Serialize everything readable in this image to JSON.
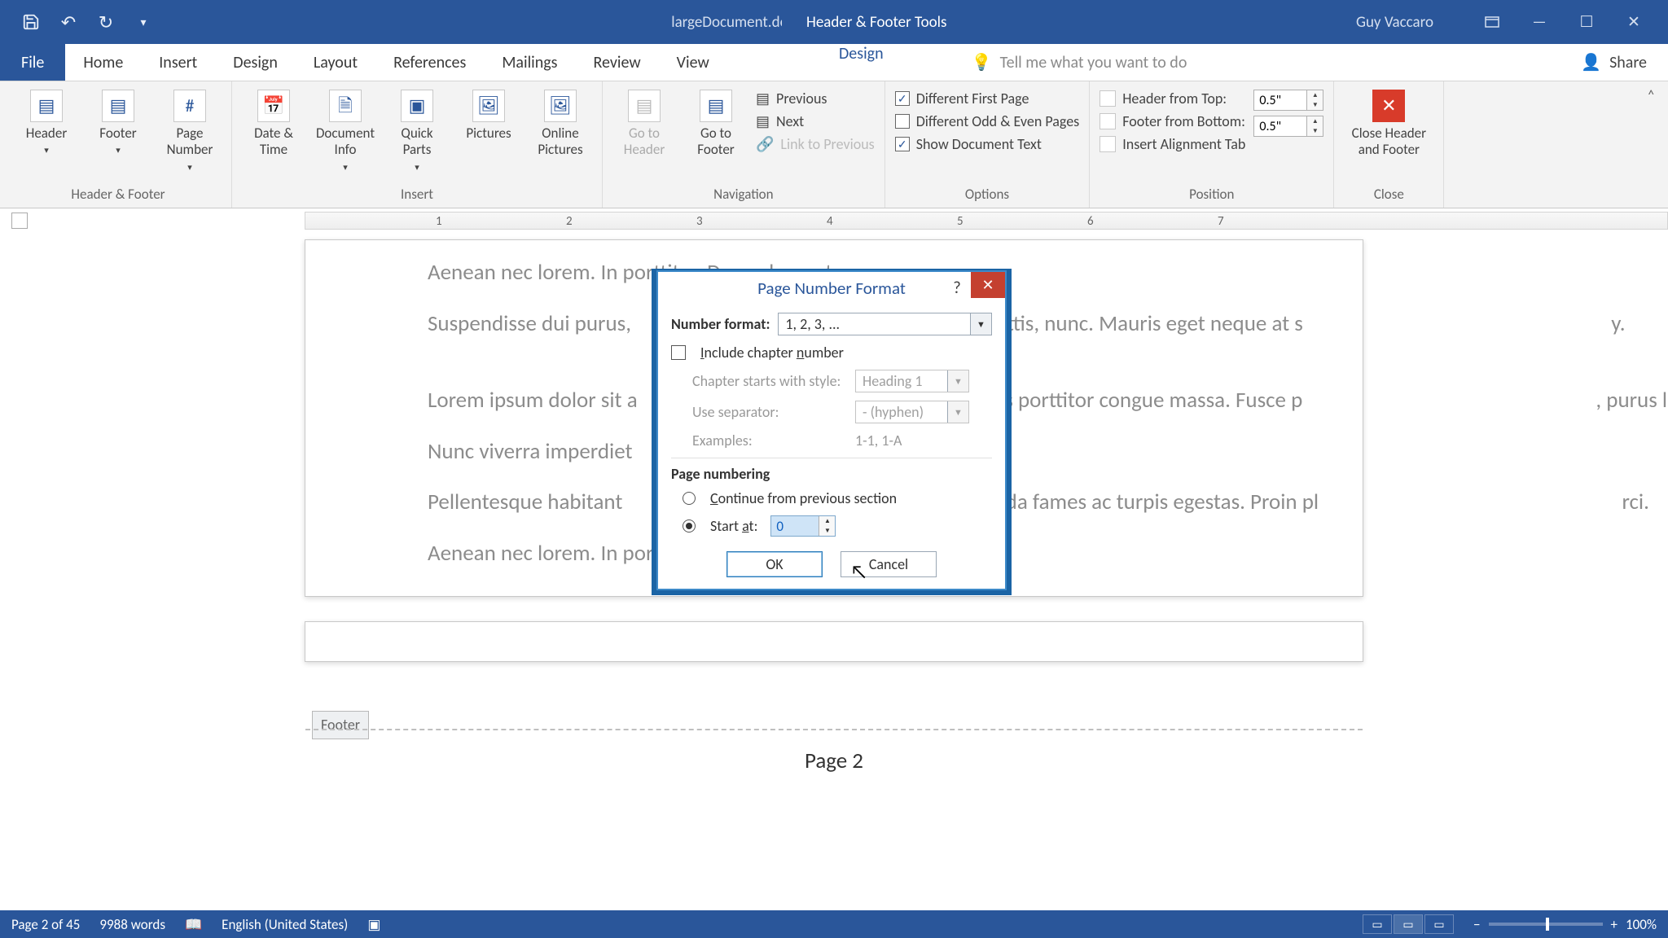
{
  "titlebar": {
    "doc_title": "largeDocument.docx - Word",
    "context_tab": "Header & Footer Tools",
    "user": "Guy Vaccaro"
  },
  "tabs": {
    "file": "File",
    "home": "Home",
    "insert": "Insert",
    "design": "Design",
    "layout": "Layout",
    "references": "References",
    "mailings": "Mailings",
    "review": "Review",
    "view": "View",
    "ctx_design": "Design",
    "tellme": "Tell me what you want to do",
    "share": "Share"
  },
  "ribbon": {
    "hf": {
      "label": "Header & Footer",
      "header": "Header",
      "footer": "Footer",
      "pagenum": "Page Number"
    },
    "insert": {
      "label": "Insert",
      "datetime": "Date & Time",
      "docinfo": "Document Info",
      "quickparts": "Quick Parts",
      "pictures": "Pictures",
      "online": "Online Pictures"
    },
    "nav": {
      "label": "Navigation",
      "gotoheader": "Go to Header",
      "gotofooter": "Go to Footer",
      "previous": "Previous",
      "next": "Next",
      "link": "Link to Previous"
    },
    "options": {
      "label": "Options",
      "diff_first": "Different First Page",
      "diff_oddeven": "Different Odd & Even Pages",
      "show_doc": "Show Document Text"
    },
    "position": {
      "label": "Position",
      "header_top": "Header from Top:",
      "footer_bottom": "Footer from Bottom:",
      "align_tab": "Insert Alignment Tab",
      "val_top": "0.5\"",
      "val_bottom": "0.5\""
    },
    "close": {
      "label": "Close",
      "btn": "Close Header and Footer"
    }
  },
  "document": {
    "p1": "Aenean nec lorem. In porttitor. Donec laoreet nonummy augue.",
    "p2": "Suspendisse dui purus,                                                              ium mattis, nunc. Mauris eget neque at s                                                              y.",
    "p3": "Lorem ipsum dolor sit a                                                             aecenas porttitor congue massa. Fusce p                                                           , purus lectus malesuada libero, sit a                                                              .",
    "p4": "Nunc viverra imperdiet",
    "p5": "Pellentesque habitant                                                              malesuada fames ac turpis egestas. Proin pl                                                             rci.",
    "p6": "Aenean nec lorem. In porttitor. Donec laoreet nonummy augue.",
    "footer_label": "Footer",
    "footer_text": "Page 2"
  },
  "dialog": {
    "title": "Page Number Format",
    "number_format_lbl": "Number format:",
    "number_format_val": "1, 2, 3, ...",
    "include_chapter": "Include chapter number",
    "chapter_style_lbl": "Chapter starts with style:",
    "chapter_style_val": "Heading 1",
    "separator_lbl": "Use separator:",
    "separator_val": "-   (hyphen)",
    "examples_lbl": "Examples:",
    "examples_val": "1-1, 1-A",
    "page_numbering": "Page numbering",
    "continue": "Continue from previous section",
    "start_at_lbl": "Start at:",
    "start_at_val": "0",
    "ok": "OK",
    "cancel": "Cancel"
  },
  "status": {
    "page": "Page 2 of 45",
    "words": "9988 words",
    "lang": "English (United States)",
    "zoom": "100%"
  },
  "ruler": {
    "n1": "1",
    "n2": "2",
    "n3": "3",
    "n4": "4",
    "n5": "5",
    "n6": "6",
    "n7": "7"
  }
}
